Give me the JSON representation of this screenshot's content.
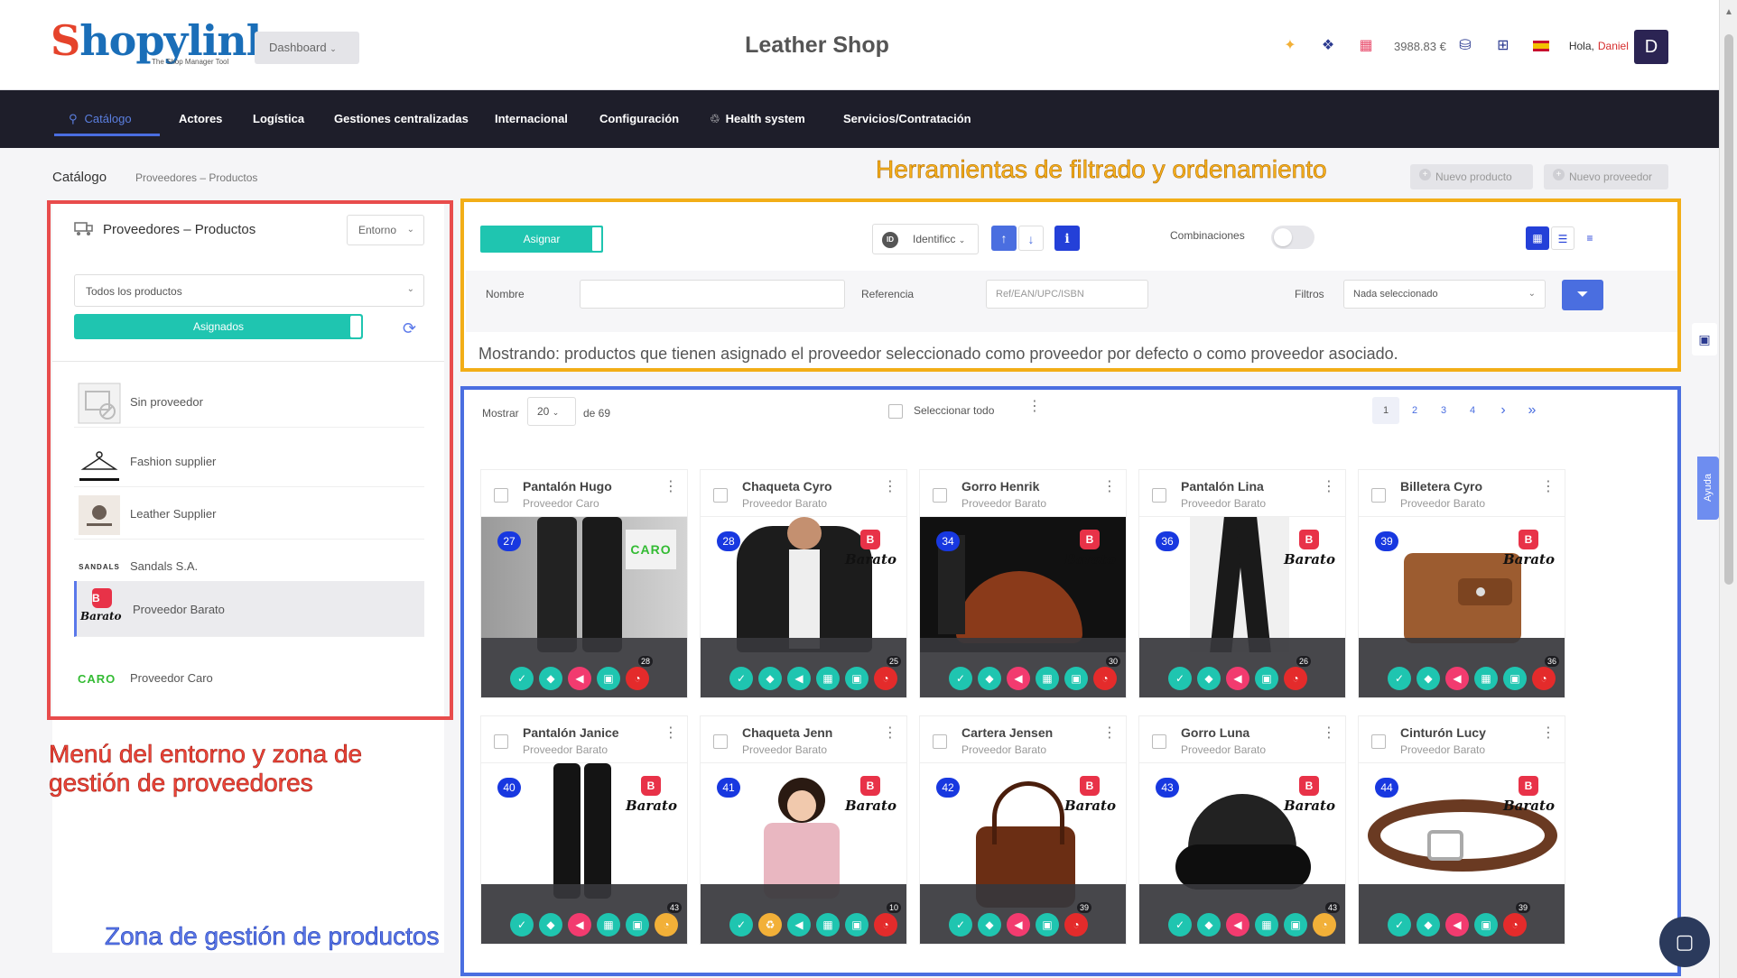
{
  "header": {
    "logo_main": "hopylinker",
    "logo_initial": "S",
    "logo_tagline": "The Shop Manager Tool",
    "dashboard_label": "Dashboard",
    "shop_title": "Leather Shop",
    "balance": "3988.83 €",
    "greeting": "Hola,",
    "user_name": "Daniel",
    "avatar_initial": "D"
  },
  "nav": {
    "items": [
      "Catálogo",
      "Actores",
      "Logística",
      "Gestiones centralizadas",
      "Internacional",
      "Configuración",
      "Health system",
      "Servicios/Contratación"
    ]
  },
  "breadcrumb": {
    "title": "Catálogo",
    "sub": "Proveedores – Productos",
    "new_product": "Nuevo producto",
    "new_supplier": "Nuevo proveedor"
  },
  "annotations": {
    "filter_tools": "Herramientas de filtrado y ordenamiento",
    "env_menu_line1": "Menú del entorno y zona de",
    "env_menu_line2": "gestión de proveedores",
    "product_zone": "Zona de gestión de productos"
  },
  "left_panel": {
    "title": "Proveedores – Productos",
    "env_select": "Entorno",
    "products_select": "Todos los productos",
    "assigned_toggle": "Asignados",
    "suppliers": [
      {
        "name": "Sin proveedor",
        "logo": ""
      },
      {
        "name": "Fashion supplier",
        "logo": ""
      },
      {
        "name": "Leather Supplier",
        "logo": ""
      },
      {
        "name": "Sandals S.A.",
        "logo": "SANDALS"
      },
      {
        "name": "Proveedor Barato",
        "logo": "Barato"
      },
      {
        "name": "Proveedor Caro",
        "logo": "CARO"
      }
    ]
  },
  "filters": {
    "assign_label": "Asignar",
    "id_badge": "ID",
    "sort_field": "Identificc",
    "combinations_label": "Combinaciones",
    "name_label": "Nombre",
    "name_value": "",
    "reference_label": "Referencia",
    "reference_placeholder": "Ref/EAN/UPC/ISBN",
    "filters_label": "Filtros",
    "filters_value": "Nada seleccionado",
    "showing_text": "Mostrando: productos que tienen asignado el proveedor seleccionado como proveedor por defecto o como proveedor asociado."
  },
  "side": {
    "help_label": "Ayuda"
  },
  "products_zone": {
    "show_label": "Mostrar",
    "per_page": "20",
    "total": "de 69",
    "select_all": "Seleccionar todo",
    "pages": [
      "1",
      "2",
      "3",
      "4"
    ],
    "next": "›",
    "last": "»"
  },
  "products": [
    {
      "name": "Pantalón Hugo",
      "supplier": "Proveedor Caro",
      "id": "27",
      "brand": "CARO",
      "count": "28",
      "icons": [
        "teal-check",
        "teal-tag",
        "pink-megaphone",
        "teal-truck",
        "red-gauge"
      ]
    },
    {
      "name": "Chaqueta Cyro",
      "supplier": "Proveedor Barato",
      "id": "28",
      "brand": "Barato",
      "count": "25",
      "icons": [
        "teal-check",
        "teal-tag",
        "teal-megaphone",
        "teal-grid",
        "teal-truck",
        "red-gauge"
      ]
    },
    {
      "name": "Gorro Henrik",
      "supplier": "Proveedor Barato",
      "id": "34",
      "brand": "Barato",
      "count": "30",
      "icons": [
        "teal-check",
        "teal-tag",
        "pink-megaphone",
        "teal-grid",
        "teal-truck",
        "red-gauge"
      ]
    },
    {
      "name": "Pantalón Lina",
      "supplier": "Proveedor Barato",
      "id": "36",
      "brand": "Barato",
      "count": "26",
      "icons": [
        "teal-check",
        "teal-tag",
        "pink-megaphone",
        "teal-truck",
        "red-gauge"
      ]
    },
    {
      "name": "Billetera Cyro",
      "supplier": "Proveedor Barato",
      "id": "39",
      "brand": "Barato",
      "count": "36",
      "icons": [
        "teal-check",
        "teal-tag",
        "pink-megaphone",
        "teal-grid",
        "teal-truck",
        "red-gauge"
      ]
    },
    {
      "name": "Pantalón Janice",
      "supplier": "Proveedor Barato",
      "id": "40",
      "brand": "Barato",
      "count": "43",
      "icons": [
        "teal-check",
        "teal-tag",
        "pink-megaphone",
        "teal-grid",
        "teal-truck",
        "orange-gauge"
      ]
    },
    {
      "name": "Chaqueta Jenn",
      "supplier": "Proveedor Barato",
      "id": "41",
      "brand": "Barato",
      "count": "10",
      "icons": [
        "teal-check",
        "orange-recycle",
        "teal-megaphone",
        "teal-grid",
        "teal-truck",
        "red-gauge"
      ]
    },
    {
      "name": "Cartera Jensen",
      "supplier": "Proveedor Barato",
      "id": "42",
      "brand": "Barato",
      "count": "39",
      "icons": [
        "teal-check",
        "teal-tag",
        "pink-megaphone",
        "teal-truck",
        "red-gauge"
      ]
    },
    {
      "name": "Gorro Luna",
      "supplier": "Proveedor Barato",
      "id": "43",
      "brand": "Barato",
      "count": "43",
      "icons": [
        "teal-check",
        "teal-tag",
        "pink-megaphone",
        "teal-grid",
        "teal-truck",
        "orange-gauge"
      ]
    },
    {
      "name": "Cinturón Lucy",
      "supplier": "Proveedor Barato",
      "id": "44",
      "brand": "Barato",
      "count": "39",
      "icons": [
        "teal-check",
        "teal-tag",
        "pink-megaphone",
        "teal-truck",
        "red-gauge"
      ]
    }
  ]
}
